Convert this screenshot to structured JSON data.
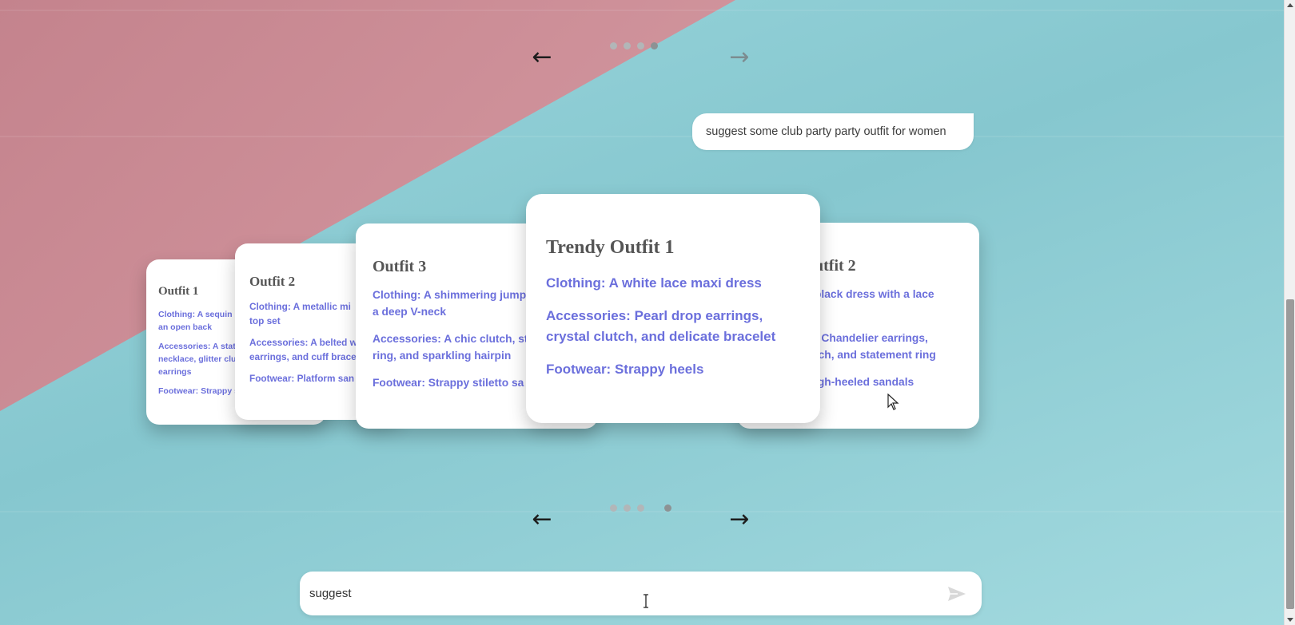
{
  "chat": {
    "user_message": "suggest some club party party outfit for women"
  },
  "carousel_top": {
    "prev_icon": "arrow-left-icon",
    "next_icon": "arrow-right-icon",
    "dots": 4
  },
  "carousel_bottom": {
    "prev_icon": "arrow-left-icon",
    "next_icon": "arrow-right-icon",
    "dots": 4
  },
  "cards": {
    "far_left": {
      "title": "Outfit 1",
      "clothing": "Clothing: A sequin l",
      "clothing_2": "an open back",
      "accessories": "Accessories: A stat",
      "accessories_2": "necklace, glitter clu",
      "accessories_3": "earrings",
      "footwear": "Footwear: Strappy s"
    },
    "left": {
      "title": "Outfit 2",
      "clothing": "Clothing: A metallic mi",
      "clothing_2": "top set",
      "accessories": "Accessories: A belted w",
      "accessories_2": "earrings, and cuff brace",
      "footwear": "Footwear: Platform san"
    },
    "mid_left": {
      "title": "Outfit 3",
      "clothing": "Clothing: A shimmering jump",
      "clothing_2": "a deep V-neck",
      "accessories": "Accessories: A chic clutch, st",
      "accessories_2": "ring, and sparkling hairpin",
      "footwear": "Footwear: Strappy stiletto sa"
    },
    "center": {
      "title": "Trendy Outfit 1",
      "clothing": "Clothing: A white lace maxi dress",
      "accessories": "Accessories: Pearl drop earrings, crystal clutch, and delicate bracelet",
      "footwear": "Footwear: Strappy heels"
    },
    "right": {
      "title": "utfit 2",
      "clothing": "black dress with a lace",
      "accessories": ": Chandelier earrings,",
      "accessories_2": "tch, and statement ring",
      "footwear": "igh-heeled sandals"
    }
  },
  "input": {
    "value": "suggest ",
    "send_icon": "send-icon"
  },
  "colors": {
    "accent_text": "#6b6fdc",
    "title_text": "#555555",
    "bg_teal": "#8fcfd6",
    "bg_pink": "#d69ba3"
  }
}
